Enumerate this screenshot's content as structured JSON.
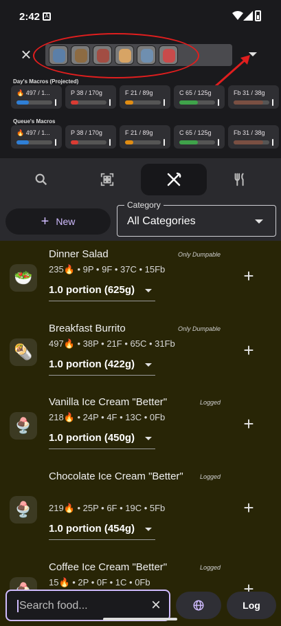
{
  "status_bar": {
    "time": "2:42"
  },
  "queue": {
    "thumbs": [
      {
        "icon": "can-icon",
        "color": "#5b7fa8"
      },
      {
        "icon": "potato-icon",
        "color": "#8d6b42"
      },
      {
        "icon": "meat-tray-icon",
        "color": "#a24d43"
      },
      {
        "icon": "egg-icon",
        "color": "#d7a465"
      },
      {
        "icon": "package-icon",
        "color": "#6f8fb0"
      },
      {
        "icon": "sauce-bottle-icon",
        "color": "#c94b4b"
      }
    ]
  },
  "days_macros": {
    "title": "Day's Macros (Projected)",
    "cards": [
      {
        "text": "🔥 497 / 1...",
        "fill": 0.35,
        "color": "#2f7fd6"
      },
      {
        "text": "P 38 / 170g",
        "fill": 0.22,
        "color": "#d93b33"
      },
      {
        "text": "F 21 / 89g",
        "fill": 0.24,
        "color": "#e08c12"
      },
      {
        "text": "C 65 / 125g",
        "fill": 0.52,
        "color": "#3fa24a"
      },
      {
        "text": "Fb 31 / 38g",
        "fill": 0.82,
        "color": "#7a4f42"
      }
    ]
  },
  "queue_macros": {
    "title": "Queue's Macros",
    "cards": [
      {
        "text": "🔥 497 / 1...",
        "fill": 0.35,
        "color": "#2f7fd6"
      },
      {
        "text": "P 38 / 170g",
        "fill": 0.22,
        "color": "#d93b33"
      },
      {
        "text": "F 21 / 89g",
        "fill": 0.24,
        "color": "#e08c12"
      },
      {
        "text": "C 65 / 125g",
        "fill": 0.52,
        "color": "#3fa24a"
      },
      {
        "text": "Fb 31 / 38g",
        "fill": 0.82,
        "color": "#7a4f42"
      }
    ]
  },
  "tabs": [
    {
      "icon": "search-icon",
      "active": false
    },
    {
      "icon": "barcode-scan-icon",
      "active": false
    },
    {
      "icon": "utensils-icon",
      "active": true
    },
    {
      "icon": "fork-knife-icon",
      "active": false
    }
  ],
  "actions": {
    "new_label": "New",
    "category_label": "Category",
    "category_value": "All Categories"
  },
  "foods": [
    {
      "emoji": "🥗",
      "name": "Dinner Salad",
      "status": "Only Dumpable",
      "macros": "235🔥 • 9P • 9F • 37C • 15Fb",
      "portion": "1.0 portion (625g)"
    },
    {
      "emoji": "🌯",
      "name": "Breakfast Burrito",
      "status": "Only Dumpable",
      "macros": "497🔥 • 38P • 21F • 65C • 31Fb",
      "portion": "1.0 portion (422g)"
    },
    {
      "emoji": "🍨",
      "name": "Vanilla Ice Cream \"Better\"",
      "status": "Logged",
      "macros": "218🔥 • 24P • 4F • 13C • 0Fb",
      "portion": "1.0 portion (450g)"
    },
    {
      "emoji": "🍨",
      "name": "Chocolate Ice Cream \"Better\"",
      "status": "Logged",
      "macros": "219🔥 • 25P • 6F • 19C • 5Fb",
      "portion": "1.0 portion (454g)"
    },
    {
      "emoji": "🍨",
      "name": "Coffee Ice Cream \"Better\"",
      "status": "Logged",
      "macros": "15🔥 • 2P • 0F • 1C • 0Fb",
      "portion": ""
    }
  ],
  "search": {
    "placeholder": "Search food...",
    "log_label": "Log"
  }
}
